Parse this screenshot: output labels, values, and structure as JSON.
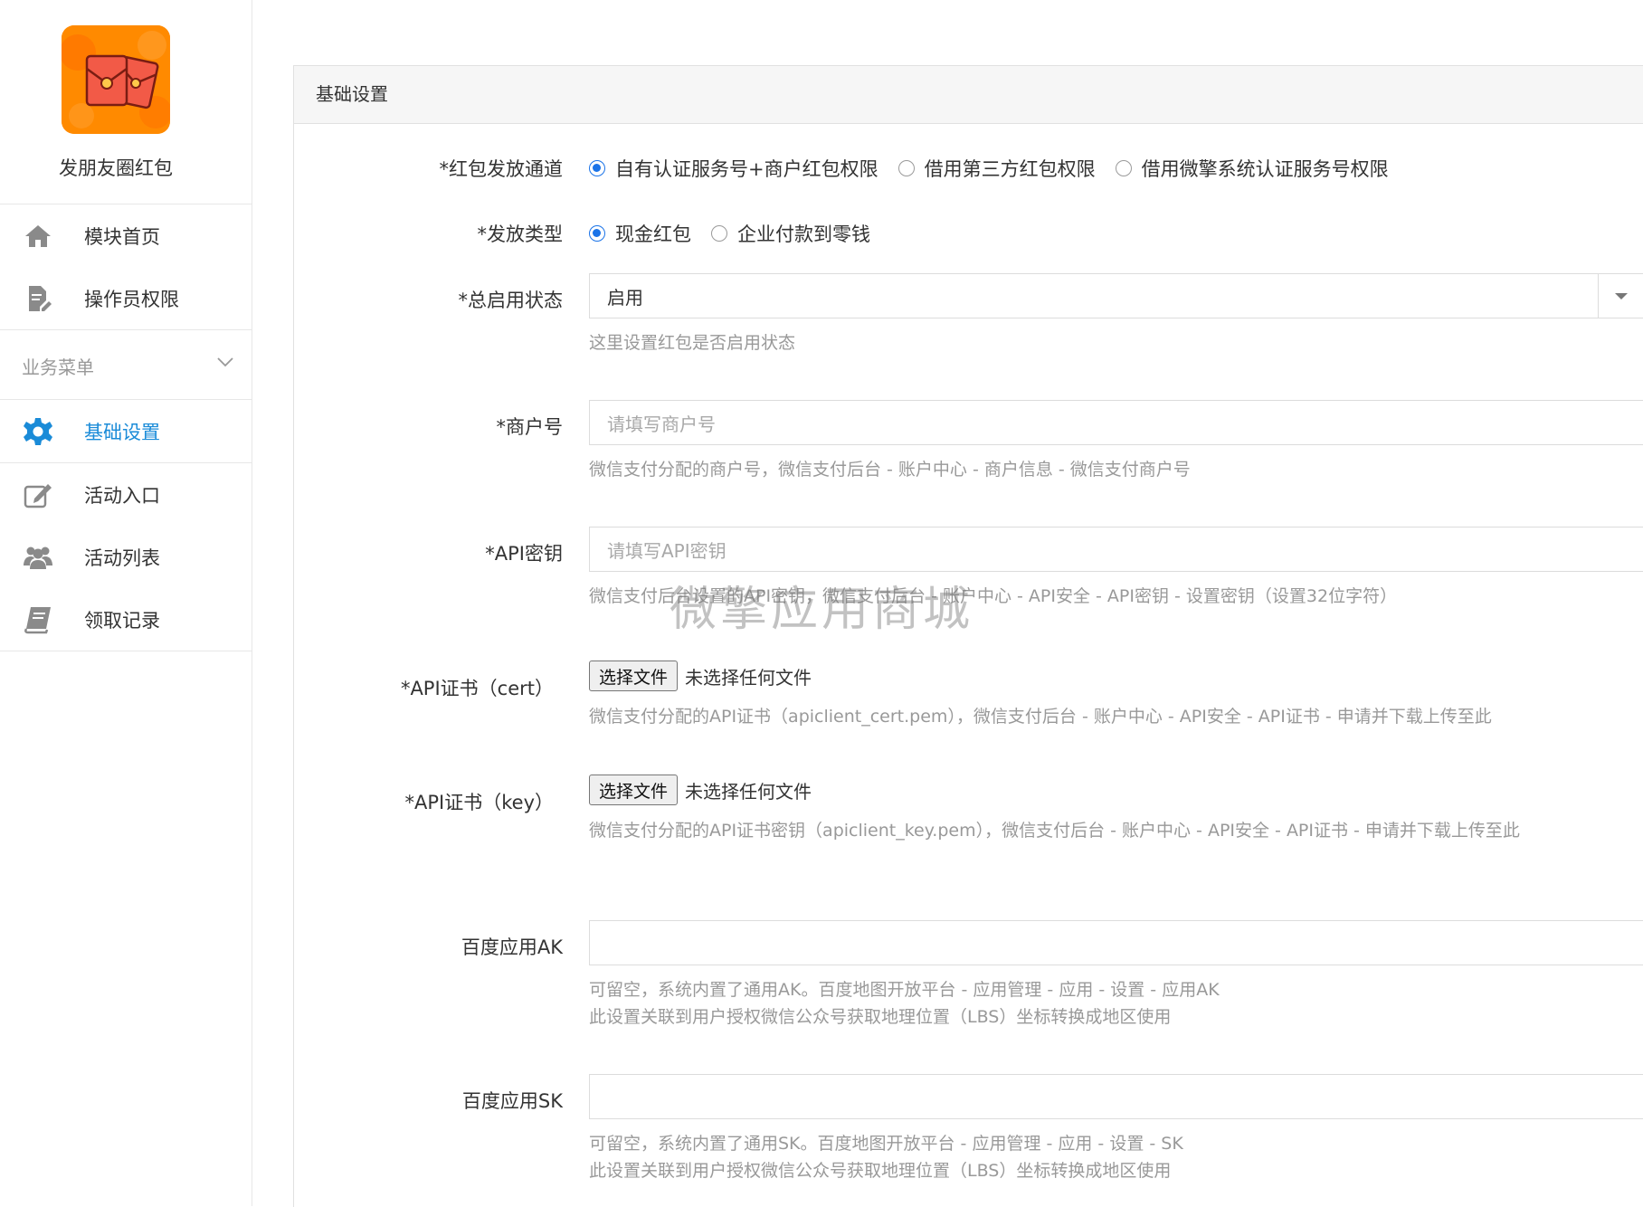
{
  "sidebar": {
    "app_name": "发朋友圈红包",
    "top_items": [
      {
        "label": "模块首页",
        "icon": "home-icon"
      },
      {
        "label": "操作员权限",
        "icon": "document-edit-icon"
      }
    ],
    "section_title": "业务菜单",
    "section_icon": "chevron-down-icon",
    "active_item": {
      "label": "基础设置",
      "icon": "gear-icon"
    },
    "items": [
      {
        "label": "活动入口",
        "icon": "edit-icon"
      },
      {
        "label": "活动列表",
        "icon": "users-icon"
      },
      {
        "label": "领取记录",
        "icon": "book-icon"
      }
    ]
  },
  "panel": {
    "title": "基础设置",
    "channel": {
      "label": "*红包发放通道",
      "options": [
        "自有认证服务号+商户红包权限",
        "借用第三方红包权限",
        "借用微擎系统认证服务号权限"
      ],
      "selected_index": 0
    },
    "type": {
      "label": "*发放类型",
      "options": [
        "现金红包",
        "企业付款到零钱"
      ],
      "selected_index": 0
    },
    "status": {
      "label": "*总启用状态",
      "value": "启用",
      "help": "这里设置红包是否启用状态"
    },
    "merchant": {
      "label": "*商户号",
      "placeholder": "请填写商户号",
      "help": "微信支付分配的商户号，微信支付后台 - 账户中心 - 商户信息 - 微信支付商户号"
    },
    "api_key": {
      "label": "*API密钥",
      "placeholder": "请填写API密钥",
      "help": "微信支付后台设置的API密钥，微信支付后台 - 账户中心 - API安全 - API密钥 - 设置密钥（设置32位字符）"
    },
    "cert": {
      "label": "*API证书（cert）",
      "button": "选择文件",
      "status": "未选择任何文件",
      "help": "微信支付分配的API证书（apiclient_cert.pem），微信支付后台 - 账户中心 - API安全 - API证书 - 申请并下载上传至此"
    },
    "key": {
      "label": "*API证书（key）",
      "button": "选择文件",
      "status": "未选择任何文件",
      "help": "微信支付分配的API证书密钥（apiclient_key.pem），微信支付后台 - 账户中心 - API安全 - API证书 - 申请并下载上传至此"
    },
    "baidu_ak": {
      "label": "百度应用AK",
      "value": "",
      "help1": "可留空，系统内置了通用AK。百度地图开放平台 - 应用管理 - 应用 - 设置 - 应用AK",
      "help2": "此设置关联到用户授权微信公众号获取地理位置（LBS）坐标转换成地区使用"
    },
    "baidu_sk": {
      "label": "百度应用SK",
      "value": "",
      "help1": "可留空，系统内置了通用SK。百度地图开放平台 - 应用管理 - 应用 - 设置 - SK",
      "help2": "此设置关联到用户授权微信公众号获取地理位置（LBS）坐标转换成地区使用"
    }
  },
  "watermark": "微擎应用商城",
  "colors": {
    "accent": "#1a8bd8",
    "radio_checked": "#1a73e8",
    "logo_bg": "#ff8a00",
    "help_text": "#999999"
  }
}
